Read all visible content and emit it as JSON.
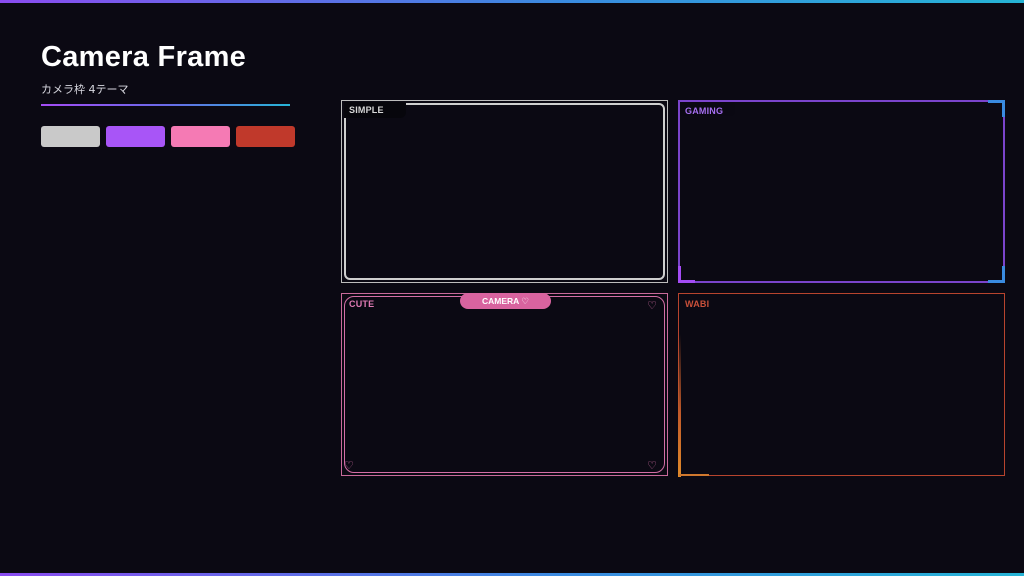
{
  "header": {
    "title": "Camera Frame",
    "subtitle": "カメラ枠 4テーマ"
  },
  "colors": {
    "accent_gradient": [
      "#a44cf5",
      "#26b4d6"
    ],
    "background": "#0b0913"
  },
  "swatches": [
    {
      "name": "simple",
      "color": "#c9c9c9"
    },
    {
      "name": "gaming",
      "color": "#a855f7"
    },
    {
      "name": "cute",
      "color": "#f57ab4"
    },
    {
      "name": "wabi",
      "color": "#c0392b"
    }
  ],
  "frames": {
    "simple": {
      "label": "SIMPLE",
      "color": "#cfcfcf"
    },
    "gaming": {
      "label": "GAMING",
      "color": "#a56ef0",
      "corner_color": "#3a8be0"
    },
    "cute": {
      "label": "CUTE",
      "badge": "CAMERA ♡",
      "heart": "♡",
      "color": "#d46ea6"
    },
    "wabi": {
      "label": "WABI",
      "color": "#c9503a"
    }
  }
}
